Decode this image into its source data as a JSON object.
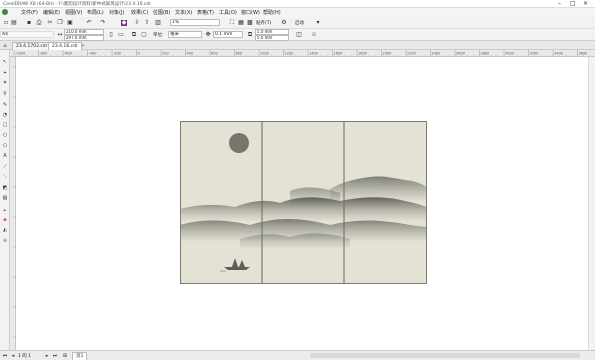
{
  "window": {
    "title": "CorelDRAW X8 (64-Bit) - F:\\墨韵设计资料\\新中式屏风设计\\23.4.16.cdr"
  },
  "menu": [
    "文件(F)",
    "编辑(E)",
    "视图(V)",
    "布局(L)",
    "对象(J)",
    "效果(C)",
    "位图(B)",
    "文本(X)",
    "表格(T)",
    "工具(O)",
    "窗口(W)",
    "帮助(H)"
  ],
  "toolbar1": {
    "zoom": "1%",
    "snap_label": "贴齐(T)",
    "launch_label": "启动"
  },
  "toolbar2": {
    "preset": "A4",
    "width": "210.0 mm",
    "height": "297.0 mm",
    "units_label": "单位:",
    "units_value": "毫米",
    "nudge": "0.1 mm",
    "dup_x": "5.0 mm",
    "dup_y": "5.0 mm"
  },
  "tabs": [
    {
      "label": "23.4.1703.cdr",
      "active": false
    },
    {
      "label": "23.4.16.cdr",
      "active": true
    }
  ],
  "ruler_h": [
    "-1000",
    "-800",
    "-600",
    "-400",
    "-200",
    "0",
    "200",
    "400",
    "600",
    "800",
    "1000",
    "1200",
    "1400",
    "1600",
    "1800",
    "2000",
    "2200",
    "2400",
    "2600",
    "2800",
    "3000",
    "3200",
    "3400",
    "3600"
  ],
  "statusbar": {
    "page_info": "1 的 1",
    "page_tab": "页1"
  },
  "colors": {
    "panel_bg": "#e9e7da",
    "ink": "#6f6f68",
    "sun": "#7a7a74"
  }
}
